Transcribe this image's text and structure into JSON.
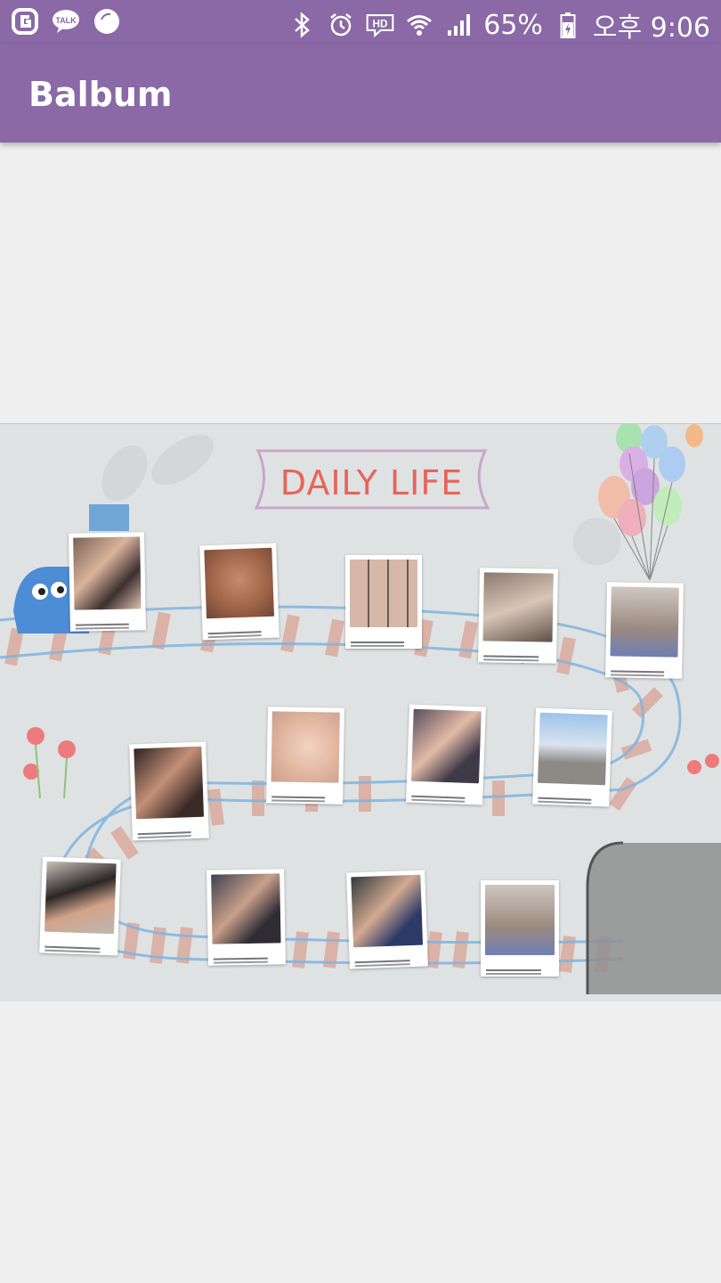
{
  "status_bar": {
    "battery": "65%",
    "time": "오후 9:06",
    "icons": [
      "g-app-icon",
      "kakaotalk-icon",
      "ball-app-icon",
      "bluetooth-icon",
      "alarm-icon",
      "hd-icon",
      "wifi-icon",
      "signal-icon",
      "battery-icon"
    ]
  },
  "app_bar": {
    "title": "Balbum"
  },
  "album": {
    "banner_text": "DAILY LIFE",
    "photos": [
      {
        "name": "photo-friends-group"
      },
      {
        "name": "photo-baby-face"
      },
      {
        "name": "photo-babies-collage"
      },
      {
        "name": "photo-kids-table"
      },
      {
        "name": "photo-girls-blue-dress"
      },
      {
        "name": "photo-two-friends-cafe"
      },
      {
        "name": "photo-sleeping-baby"
      },
      {
        "name": "photo-girl-sunglasses"
      },
      {
        "name": "photo-kids-railing"
      },
      {
        "name": "photo-man-cap"
      },
      {
        "name": "photo-family-group"
      },
      {
        "name": "photo-two-women"
      },
      {
        "name": "photo-girls-blue-dress-2"
      }
    ]
  },
  "colors": {
    "accent": "#8a69a6",
    "banner_text": "#e8645a"
  }
}
